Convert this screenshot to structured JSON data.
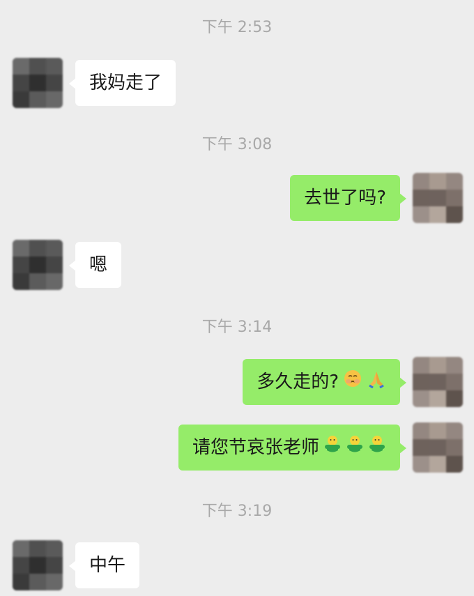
{
  "timestamps": [
    "下午 2:53",
    "下午 3:08",
    "下午 3:14",
    "下午 3:19"
  ],
  "messages": [
    {
      "side": "left",
      "text": "我妈走了"
    },
    {
      "side": "right",
      "text": "去世了吗?"
    },
    {
      "side": "left",
      "text": "嗯"
    },
    {
      "side": "right",
      "text": "多久走的?",
      "emojis": [
        "crying-face-icon",
        "praying-hands-icon"
      ]
    },
    {
      "side": "right",
      "text": "请您节哀张老师",
      "emojis": [
        "green-figure-icon",
        "green-figure-icon",
        "green-figure-icon"
      ]
    },
    {
      "side": "left",
      "text": "中午"
    }
  ],
  "colors": {
    "background": "#ededed",
    "incoming_bubble": "#ffffff",
    "outgoing_bubble": "#95ec69",
    "timestamp_text": "#a8a8a8"
  }
}
